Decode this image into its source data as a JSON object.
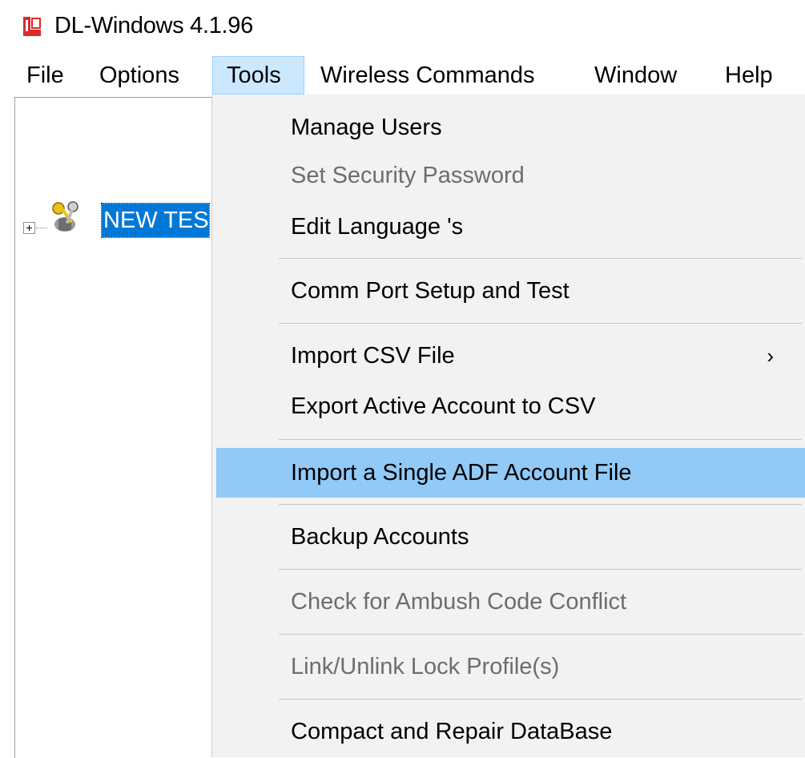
{
  "window": {
    "title": "DL-Windows 4.1.96",
    "icon": "app-lock-icon",
    "accent_color": "#d92b2b"
  },
  "menubar": {
    "items": [
      {
        "label": "File"
      },
      {
        "label": "Options"
      },
      {
        "label": "Tools",
        "open": true
      },
      {
        "label": "Wireless Commands"
      },
      {
        "label": "Window"
      },
      {
        "label": "Help"
      }
    ]
  },
  "tree": {
    "node_label": "NEW TES",
    "node_icon": "keys-icon",
    "selected_color": "#0078d7"
  },
  "tools_menu": {
    "items": [
      {
        "label": "Manage Users",
        "enabled": true
      },
      {
        "label": "Set Security Password",
        "enabled": false
      },
      {
        "label": "Edit Language 's",
        "enabled": true
      },
      {
        "label": "Comm Port Setup and Test",
        "enabled": true
      },
      {
        "label": "Import CSV File",
        "enabled": true,
        "submenu": true,
        "arrow": "›"
      },
      {
        "label": "Export Active Account to CSV",
        "enabled": true
      },
      {
        "label": "Import a Single ADF Account File",
        "enabled": true,
        "highlighted": true
      },
      {
        "label": "Backup Accounts",
        "enabled": true
      },
      {
        "label": "Check for Ambush Code Conflict",
        "enabled": false
      },
      {
        "label": "Link/Unlink Lock Profile(s)",
        "enabled": false
      },
      {
        "label": "Compact and Repair DataBase",
        "enabled": true
      }
    ],
    "highlight_color": "#91c9f7"
  }
}
